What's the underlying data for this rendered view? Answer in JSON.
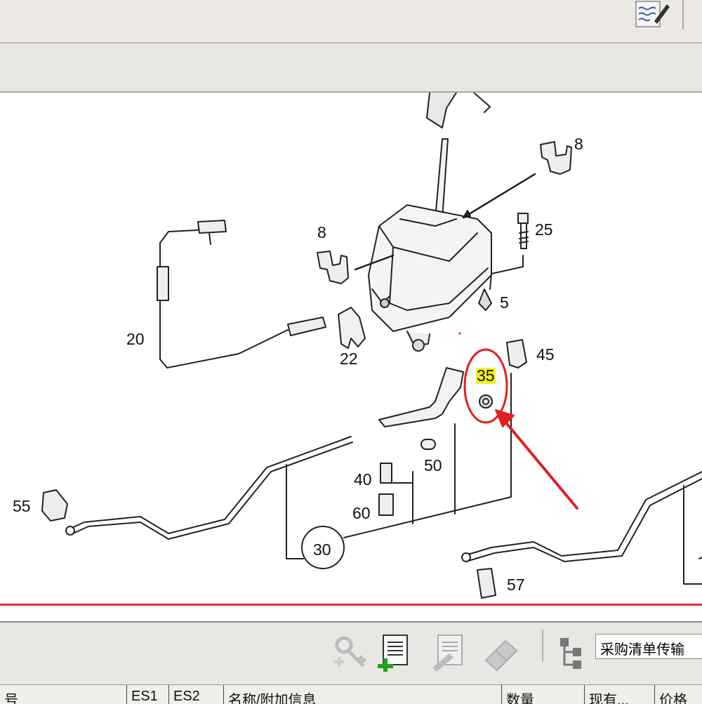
{
  "toolbar": {
    "edit_icon": "notepad-pencil-icon"
  },
  "diagram": {
    "callouts": [
      {
        "id": "8a",
        "label": "8"
      },
      {
        "id": "8b",
        "label": "8"
      },
      {
        "id": "25",
        "label": "25"
      },
      {
        "id": "5",
        "label": "5"
      },
      {
        "id": "20",
        "label": "20"
      },
      {
        "id": "22",
        "label": "22"
      },
      {
        "id": "45",
        "label": "45"
      },
      {
        "id": "35",
        "label": "35",
        "highlighted": true
      },
      {
        "id": "50",
        "label": "50"
      },
      {
        "id": "40",
        "label": "40"
      },
      {
        "id": "60",
        "label": "60"
      },
      {
        "id": "55",
        "label": "55"
      },
      {
        "id": "30",
        "label": "30"
      },
      {
        "id": "57",
        "label": "57"
      }
    ],
    "highlight_color": "#f4f01e",
    "annotation_color": "#e02020"
  },
  "bottom_toolbar": {
    "icons": [
      "key-search-icon",
      "add-document-icon",
      "document-edit-icon",
      "eraser-icon",
      "tree-hierarchy-icon"
    ],
    "combo_value": "采购清单传输"
  },
  "grid": {
    "columns": [
      "号",
      "ES1",
      "ES2",
      "名称/附加信息",
      "数量",
      "现有...",
      "价格"
    ]
  }
}
